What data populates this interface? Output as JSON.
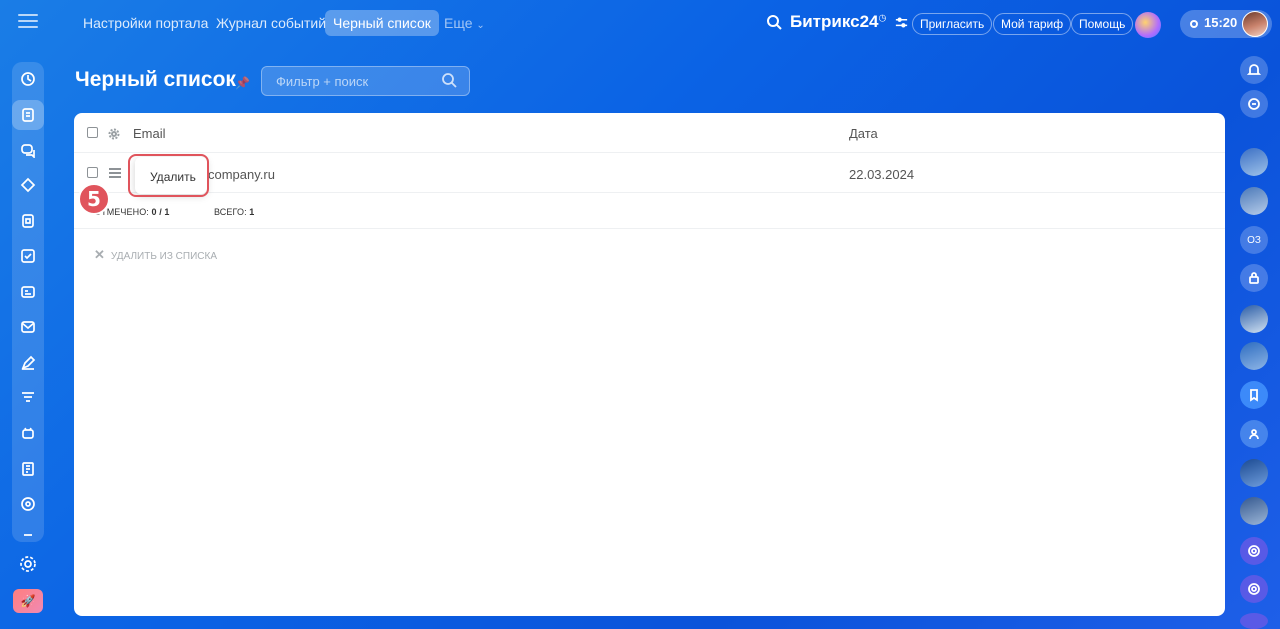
{
  "topbar": {
    "tabs": [
      {
        "label": "Настройки портала"
      },
      {
        "label": "Журнал событий"
      },
      {
        "label": "Черный список"
      },
      {
        "label": "Еще"
      }
    ],
    "brand": "Битрикс24",
    "invite_label": "Пригласить",
    "tariff_label": "Мой тариф",
    "help_label": "Помощь",
    "time": "15:20"
  },
  "page": {
    "title": "Черный список",
    "filter_placeholder": "Фильтр + поиск"
  },
  "grid": {
    "columns": {
      "email": "Email",
      "date": "Дата"
    },
    "rows": [
      {
        "email": "company.ru",
        "date": "22.03.2024"
      }
    ],
    "footer": {
      "marked_label": "ОТМЕЧЕНО:",
      "marked_value": "0 / 1",
      "total_label": "ВСЕГО:",
      "total_value": "1"
    },
    "action_label": "УДАЛИТЬ ИЗ СПИСКА"
  },
  "context_menu": {
    "delete_label": "Удалить"
  },
  "step_badge": "5",
  "right_sidebar": {
    "oz_label": "ОЗ"
  },
  "colors": {
    "accent": "#0b63e5",
    "highlight": "#e0545c"
  }
}
